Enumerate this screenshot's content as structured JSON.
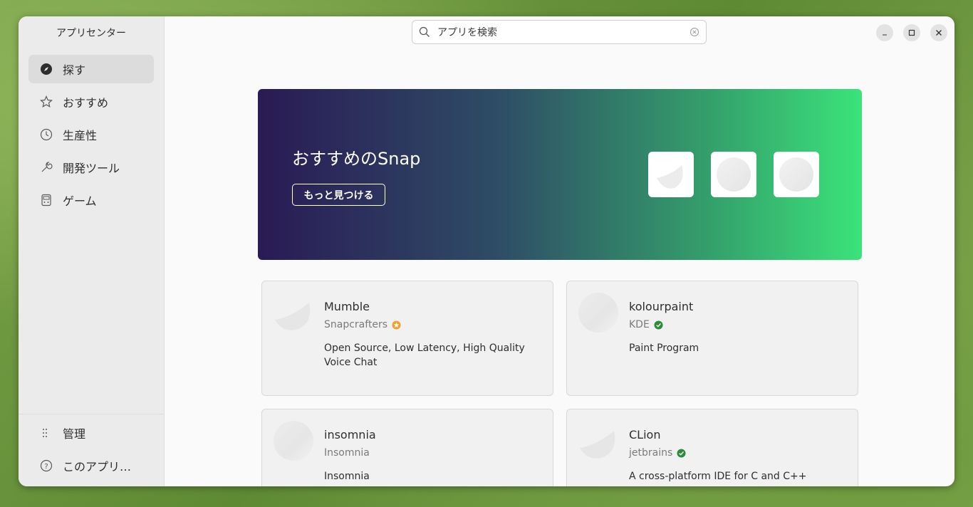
{
  "sidebar": {
    "title": "アプリセンター",
    "items": [
      {
        "label": "探す",
        "icon": "compass-icon"
      },
      {
        "label": "おすすめ",
        "icon": "star-icon"
      },
      {
        "label": "生産性",
        "icon": "clock-icon"
      },
      {
        "label": "開発ツール",
        "icon": "wrench-icon"
      },
      {
        "label": "ゲーム",
        "icon": "gamepad-icon"
      }
    ],
    "bottom": [
      {
        "label": "管理",
        "icon": "grid-icon"
      },
      {
        "label": "このアプリ…",
        "icon": "help-icon"
      }
    ]
  },
  "search": {
    "placeholder": "アプリを検索",
    "value": "アプリを検索"
  },
  "banner": {
    "title": "おすすめのSnap",
    "button": "もっと見つける"
  },
  "cards": [
    {
      "name": "Mumble",
      "publisher": "Snapcrafters",
      "badge": "star-developer",
      "description": "Open Source, Low Latency, High Quality Voice Chat"
    },
    {
      "name": "kolourpaint",
      "publisher": "KDE",
      "badge": "verified",
      "description": "Paint Program"
    },
    {
      "name": "insomnia",
      "publisher": "Insomnia",
      "badge": "",
      "description": "Insomnia"
    },
    {
      "name": "CLion",
      "publisher": "jetbrains",
      "badge": "verified",
      "description": "A cross-platform IDE for C and C++"
    }
  ],
  "colors": {
    "verified": "#2e8b3e",
    "star": "#f0a030",
    "accent_start": "#2a1a55",
    "accent_end": "#3be37a"
  }
}
